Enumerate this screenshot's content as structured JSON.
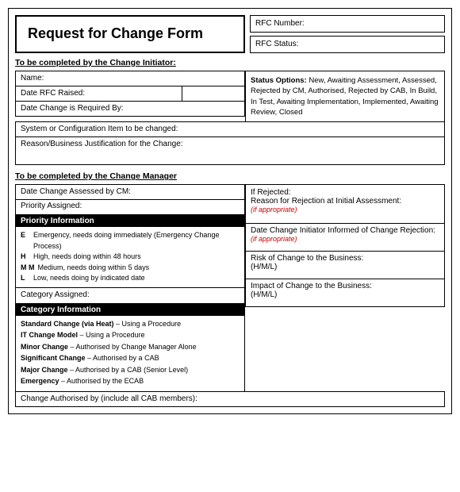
{
  "title": "Request for Change Form",
  "rfc": {
    "number_label": "RFC Number:",
    "status_label": "RFC Status:"
  },
  "initiator": {
    "section_label": "To be completed by the Change Initiator:",
    "name_label": "Name:",
    "date_raised_label": "Date RFC Raised:",
    "date_required_label": "Date Change is Required By:",
    "system_label": "System or Configuration Item to be changed:",
    "reason_label": "Reason/Business Justification for the Change:"
  },
  "status_options": {
    "bold_text": "Status Options:",
    "options_text": " New, Awaiting Assessment, Assessed, Rejected by CM, Authorised, Rejected by CAB, In Build, In Test, Awaiting Implementation, Implemented, Awaiting Review, Closed"
  },
  "manager": {
    "section_label": "To be completed by the Change Manager",
    "date_assessed_label": "Date Change Assessed by CM:",
    "priority_assigned_label": "Priority Assigned:",
    "priority_header": "Priority Information",
    "priority_items": [
      {
        "code": "E",
        "desc": "Emergency, needs doing immediately (Emergency Change Process)"
      },
      {
        "code": "H",
        "desc": "High, needs doing within 48 hours"
      },
      {
        "code": "M M",
        "desc": "Medium, needs doing within 5 days"
      },
      {
        "code": "L",
        "desc": "Low, needs doing by indicated date"
      }
    ],
    "category_assigned_label": "Category Assigned:",
    "category_header": "Category Information",
    "category_items": [
      {
        "bold": "Standard Change (via Heat)",
        "sep": " – ",
        "plain": "Using a Procedure"
      },
      {
        "bold": "IT Change Model",
        "sep": " – ",
        "plain": "Using a Procedure"
      },
      {
        "bold": "Minor Change",
        "sep": " – Authorised by ",
        "plain": "Change Manager Alone"
      },
      {
        "bold": "Significant Change",
        "sep": " – Authorised by ",
        "plain": "a CAB"
      },
      {
        "bold": "Major Change",
        "sep": " – Authorised by a CAB ",
        "plain": "(Senior Level)"
      },
      {
        "bold": "Emergency",
        "sep": " – Authorised by ",
        "plain": "the ECAB"
      }
    ],
    "change_authorised_label": "Change Authorised by (include all CAB members):",
    "if_rejected_label": "If Rejected:",
    "rejection_reason_label": "Reason for Rejection at Initial Assessment:",
    "if_appropriate": "(if appropriate)",
    "informed_label": "Date Change Initiator Informed of Change Rejection:",
    "risk_label": "Risk of Change to the Business:",
    "risk_scale": "(H/M/L)",
    "impact_label": "Impact of Change to the Business:",
    "impact_scale": "(H/M/L)"
  }
}
